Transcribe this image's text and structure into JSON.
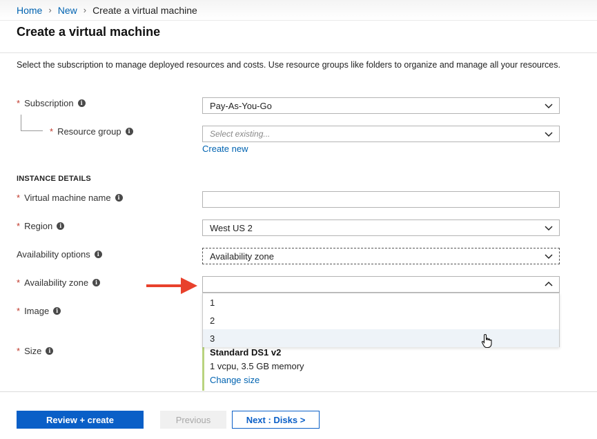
{
  "breadcrumb": {
    "home": "Home",
    "new": "New",
    "current": "Create a virtual machine"
  },
  "page": {
    "title": "Create a virtual machine",
    "intro": "Select the subscription to manage deployed resources and costs. Use resource groups like folders to organize and manage all your resources."
  },
  "project": {
    "subscription_label": "Subscription",
    "subscription_value": "Pay-As-You-Go",
    "resource_group_label": "Resource group",
    "resource_group_placeholder": "Select existing...",
    "create_new_link": "Create new"
  },
  "instance": {
    "section_title": "INSTANCE DETAILS",
    "vm_name_label": "Virtual machine name",
    "vm_name_value": "",
    "region_label": "Region",
    "region_value": "West US 2",
    "availability_options_label": "Availability options",
    "availability_options_value": "Availability zone",
    "availability_zone_label": "Availability zone",
    "availability_zone_value": "",
    "availability_zone_options": [
      "1",
      "2",
      "3"
    ],
    "image_label": "Image",
    "size_label": "Size",
    "size_name": "Standard DS1 v2",
    "size_spec": "1 vcpu, 3.5 GB memory",
    "change_size_link": "Change size"
  },
  "footer": {
    "review_create": "Review + create",
    "previous": "Previous",
    "next": "Next : Disks >"
  },
  "icons": {
    "info": "info-icon",
    "chevron": "chevron-down-icon",
    "arrow": "red-arrow-icon",
    "cursor": "hand-pointer-icon"
  },
  "colors": {
    "link": "#0063b1",
    "primary": "#0a5fc7",
    "required": "#c0392b",
    "arrow": "#e8412c",
    "size_accent": "#b9d37f"
  }
}
